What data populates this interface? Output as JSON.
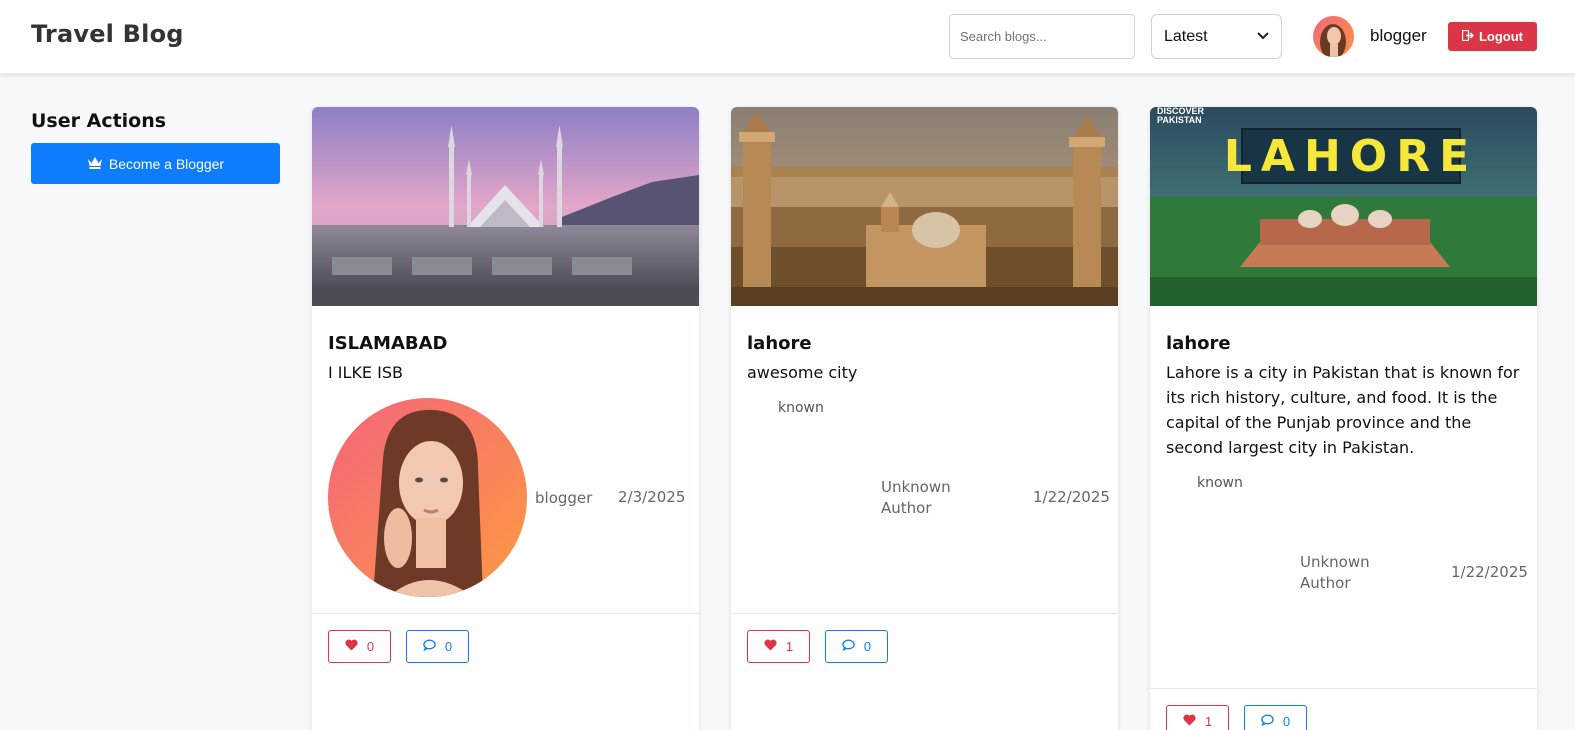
{
  "header": {
    "brand": "Travel Blog",
    "search_placeholder": "Search blogs...",
    "sort_selected": "Latest",
    "username": "blogger",
    "logout_label": "Logout"
  },
  "sidebar": {
    "title": "User Actions",
    "become_label": "Become a Blogger"
  },
  "posts": [
    {
      "title": "ISLAMABAD",
      "description": "I ILKE ISB",
      "author": "blogger",
      "date": "2/3/2025",
      "likes": "0",
      "comments": "0"
    },
    {
      "title": "lahore",
      "description": "awesome city",
      "author_image_alt": "known",
      "author": "Unknown Author",
      "date": "1/22/2025",
      "likes": "1",
      "comments": "0"
    },
    {
      "title": "lahore",
      "description": "Lahore is a city in Pakistan that is known for its rich history, culture, and food. It is the capital of the Punjab province and the second largest city in Pakistan.",
      "image_text": "LAHORE",
      "image_badge": "DISCOVER PAKISTAN",
      "author_image_alt": "known",
      "author": "Unknown Author",
      "date": "1/22/2025",
      "likes": "1",
      "comments": "0"
    }
  ],
  "colors": {
    "primary": "#0d7dfd",
    "danger": "#dc3545",
    "background": "#f7f8fa"
  }
}
